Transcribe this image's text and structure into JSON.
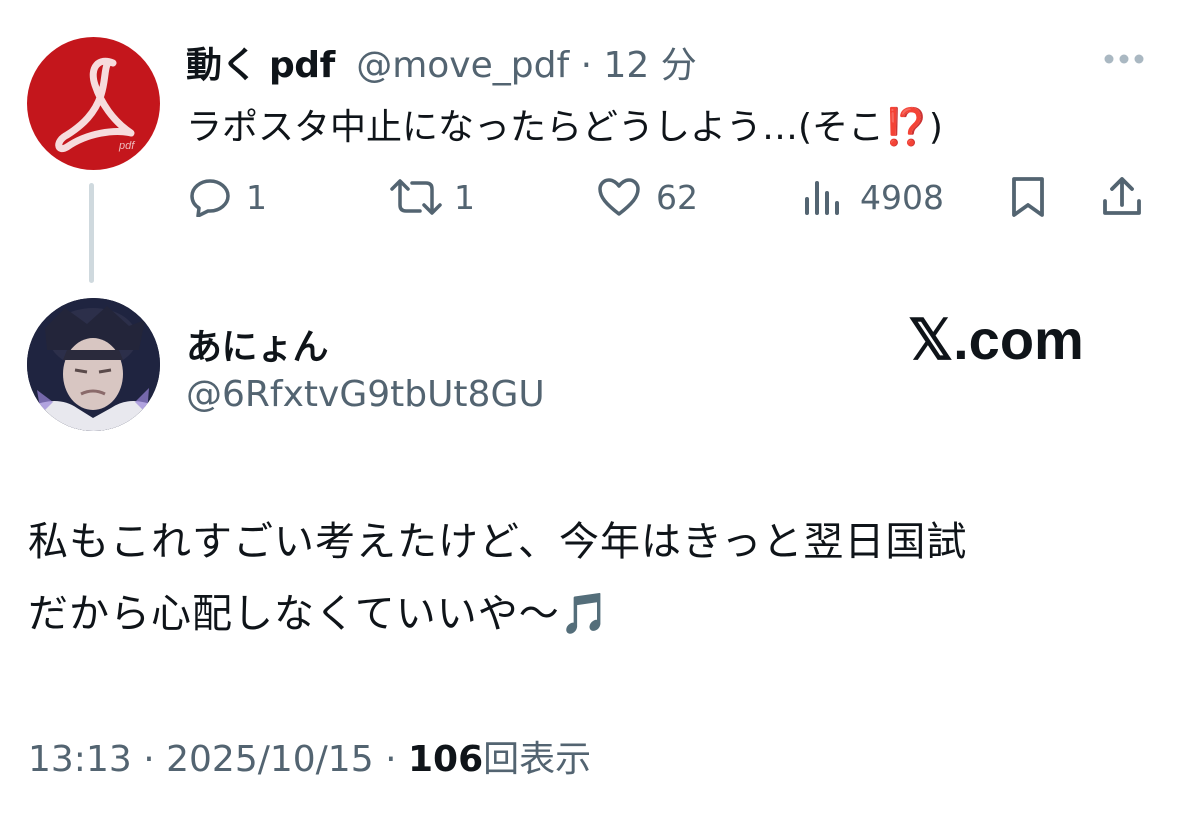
{
  "original_tweet": {
    "author_name": "動く pdf",
    "handle": "@move_pdf",
    "separator": "·",
    "time_ago": "12 分",
    "text": "ラポスタ中止になったらどうしよう…(そこ⁉️)",
    "avatar_icon": "acrobat-pdf-logo-icon",
    "avatar_color": "#c4161c",
    "actions": {
      "reply_count": "1",
      "retweet_count": "1",
      "like_count": "62",
      "view_count": "4908"
    }
  },
  "reply": {
    "author_name": "あにょん",
    "handle": "@6RfxtvG9tbUt8GU",
    "text_line1": "私もこれすごい考えたけど、今年はきっと翌日国試",
    "text_line2": "だから心配しなくていいや〜🎵",
    "time": "13:13",
    "separator": "·",
    "date": "2025/10/15",
    "views": "106",
    "views_label": "回表示"
  },
  "watermark": "𝕏.com",
  "colors": {
    "muted": "#536471",
    "text": "#0f1419",
    "thread_line": "#cfd9de"
  }
}
